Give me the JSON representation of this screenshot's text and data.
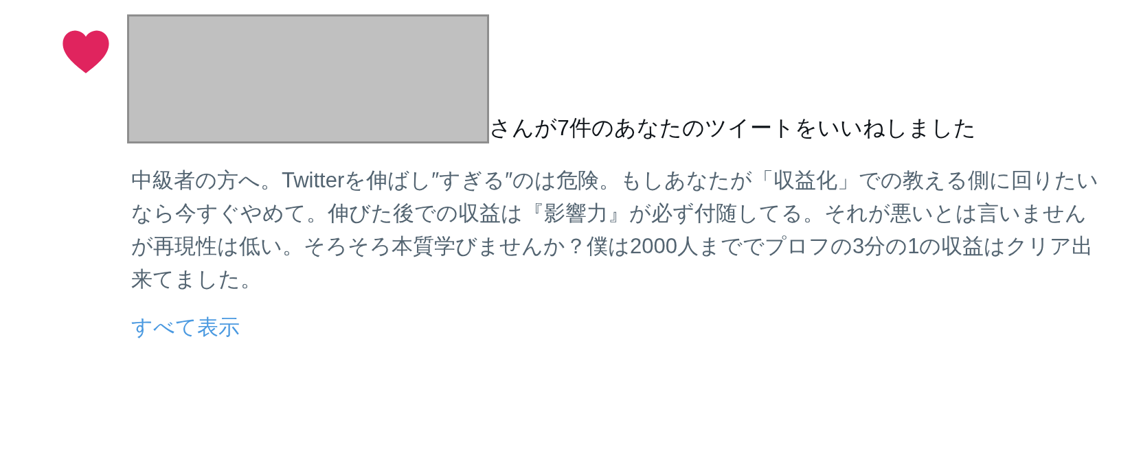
{
  "notification": {
    "kind": "like",
    "message": "さんが7件のあなたのツイートをいいねしました",
    "tweet_text": "中級者の方へ。Twitterを伸ばし″すぎる″のは危険。もしあなたが「収益化」での教える側に回りたいなら今すぐやめて。伸びた後での収益は『影響力』が必ず付随してる。それが悪いとは言いませんが再現性は低い。そろそろ本質学びませんか？僕は2000人まででプロフの3分の1の収益はクリア出来てました。",
    "show_all_link": "すべて表示"
  }
}
